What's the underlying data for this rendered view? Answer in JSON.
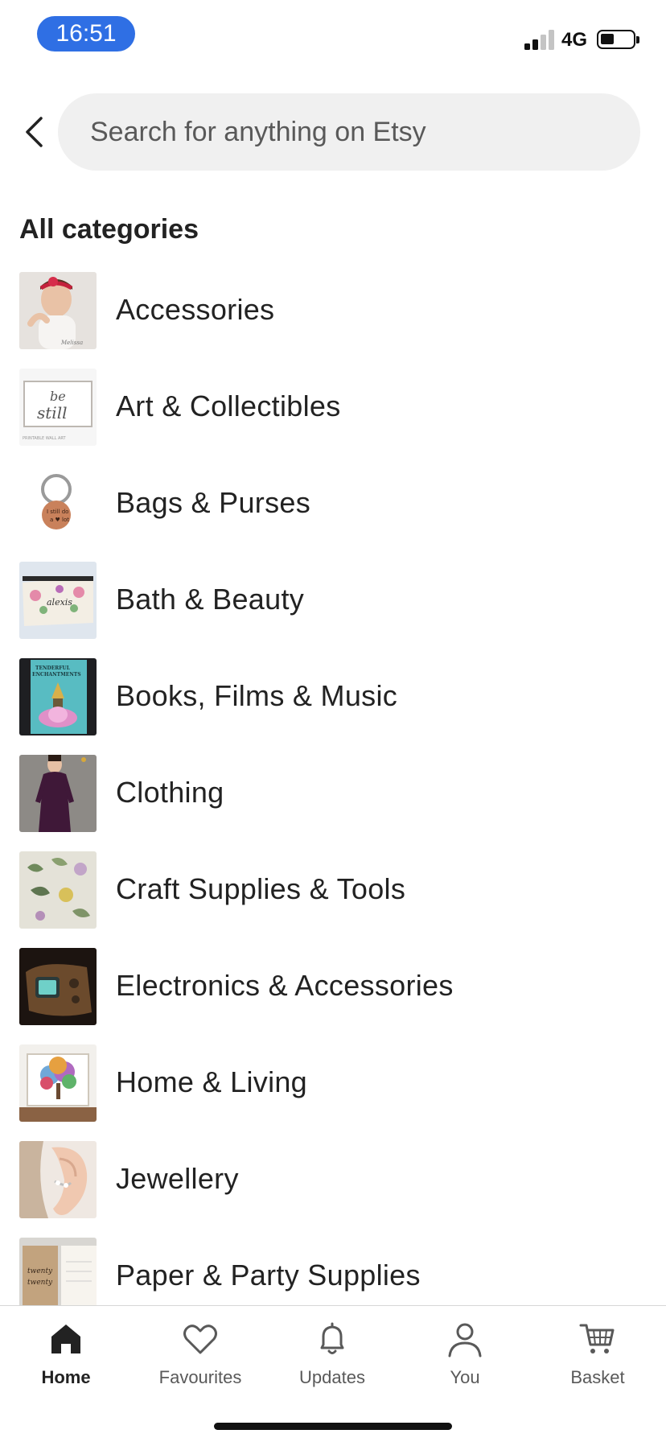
{
  "status_bar": {
    "time": "16:51",
    "network": "4G",
    "time_pill_color": "#2f6fe4",
    "signal_bars_filled": 2,
    "signal_bars_total": 4
  },
  "header": {
    "back_icon": "chevron-left-icon",
    "search_placeholder": "Search for anything on Etsy"
  },
  "section_title": "All categories",
  "categories": [
    {
      "label": "Accessories",
      "thumb": "girl-headband"
    },
    {
      "label": "Art & Collectibles",
      "thumb": "be-still-print"
    },
    {
      "label": "Bags & Purses",
      "thumb": "keyring"
    },
    {
      "label": "Bath & Beauty",
      "thumb": "floral-pouch"
    },
    {
      "label": "Books, Films & Music",
      "thumb": "book-cover"
    },
    {
      "label": "Clothing",
      "thumb": "purple-dress"
    },
    {
      "label": "Craft Supplies & Tools",
      "thumb": "botanical-paper"
    },
    {
      "label": "Electronics & Accessories",
      "thumb": "retro-device"
    },
    {
      "label": "Home & Living",
      "thumb": "tree-print"
    },
    {
      "label": "Jewellery",
      "thumb": "ear-cuff"
    },
    {
      "label": "Paper & Party Supplies",
      "thumb": "planner"
    }
  ],
  "bottom_nav": [
    {
      "label": "Home",
      "icon": "home-icon",
      "active": true
    },
    {
      "label": "Favourites",
      "icon": "heart-icon",
      "active": false
    },
    {
      "label": "Updates",
      "icon": "bell-icon",
      "active": false
    },
    {
      "label": "You",
      "icon": "user-icon",
      "active": false
    },
    {
      "label": "Basket",
      "icon": "cart-icon",
      "active": false
    }
  ]
}
